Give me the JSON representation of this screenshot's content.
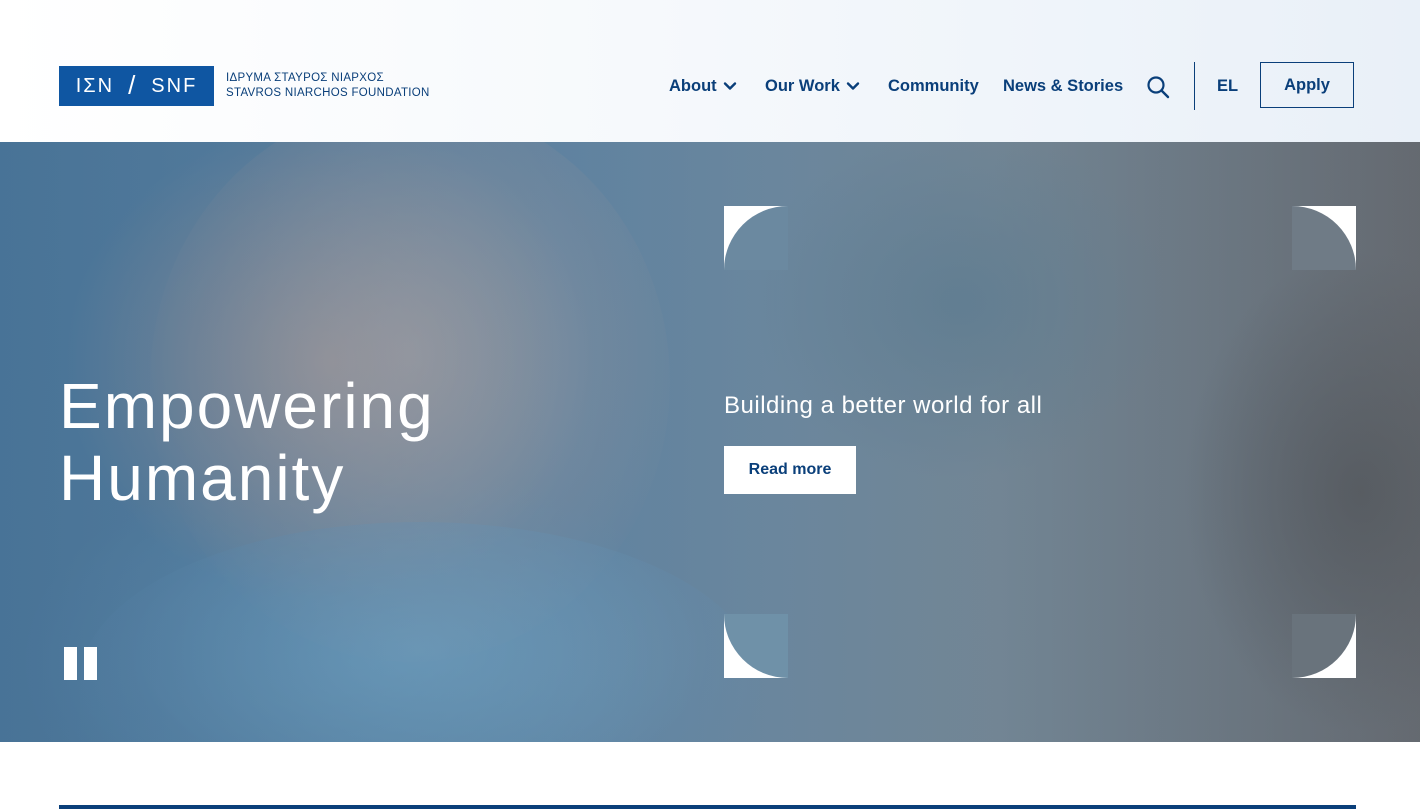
{
  "logo": {
    "short": "ΙΣΝ",
    "short_en": "SNF",
    "line1": "ΙΔΡΥΜΑ ΣΤΑΥΡΟΣ ΝΙΑΡΧΟΣ",
    "line2": "STAVROS NIARCHOS FOUNDATION"
  },
  "nav": {
    "items": [
      {
        "label": "About"
      },
      {
        "label": "Our Work"
      },
      {
        "label": "Community"
      },
      {
        "label": "News & Stories"
      }
    ],
    "language": "EL",
    "apply_label": "Apply"
  },
  "hero": {
    "title_line1": "Empowering",
    "title_line2": "Humanity",
    "subtitle": "Building a better world for all",
    "cta_label": "Read more"
  },
  "colors": {
    "brand_blue": "#0f56a2",
    "nav_text": "#0a3f7a"
  }
}
